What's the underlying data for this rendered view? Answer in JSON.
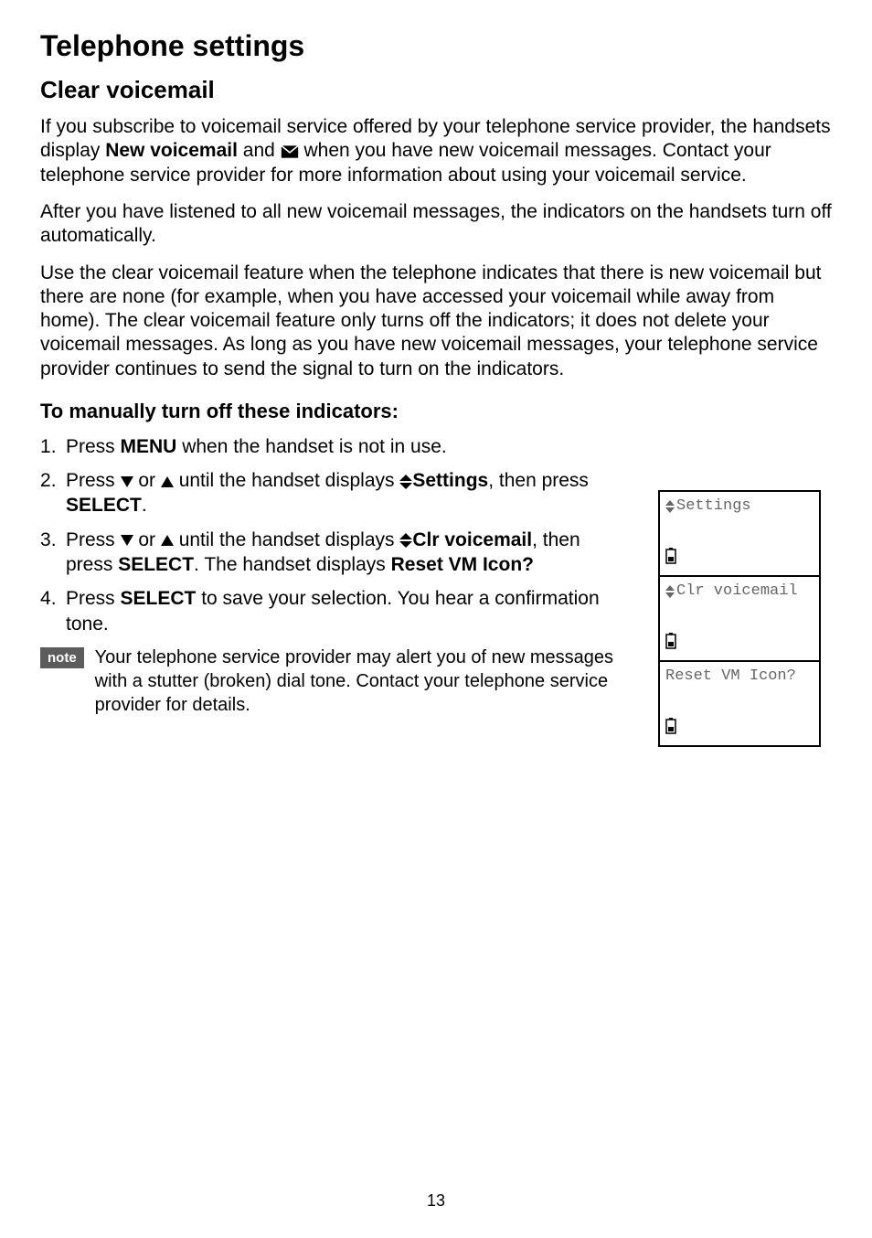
{
  "title": "Telephone settings",
  "section": "Clear voicemail",
  "para1_a": "If you subscribe to voicemail service offered by your telephone service provider, the handsets display ",
  "para1_b_bold": "New voicemail",
  "para1_c": " and ",
  "para1_d": " when you have new voicemail messages. Contact your telephone service provider for more information about using your voicemail service.",
  "para2": "After you have listened to all new voicemail messages, the indicators on the handsets turn off automatically.",
  "para3": "Use the clear voicemail feature when the telephone indicates that there is new voicemail but there are none (for example, when you have accessed your voicemail while away from home). The clear voicemail feature only turns off the indicators; it does not delete your voicemail messages. As long as you have new voicemail messages, your telephone service provider continues to send the signal to turn on the indicators.",
  "subhead": "To manually turn off these indicators:",
  "steps": {
    "s1_a": "Press ",
    "s1_menu": "MENU",
    "s1_b": " when the handset is not in use.",
    "s2_a": "Press ",
    "s2_or": " or ",
    "s2_b": " until the handset displays ",
    "s2_settings": "Settings",
    "s2_c": ", then press ",
    "s2_select": "SELECT",
    "s2_d": ".",
    "s3_a": "Press ",
    "s3_or": " or ",
    "s3_b": " until the handset displays ",
    "s3_clr": "Clr voicemail",
    "s3_c": ", then press ",
    "s3_select": "SELECT",
    "s3_d": ". The handset displays ",
    "s3_reset": "Reset VM Icon?",
    "s4_a": "Press ",
    "s4_select": "SELECT",
    "s4_b": " to save your selection. You hear a confirmation tone."
  },
  "note_label": "note",
  "note_text": "Your telephone service provider may alert you of new messages with a stutter (broken) dial tone. Contact your telephone service provider for details.",
  "screens": {
    "s1": "Settings",
    "s2": "Clr voicemail",
    "s3": "Reset VM Icon?"
  },
  "page_number": "13"
}
